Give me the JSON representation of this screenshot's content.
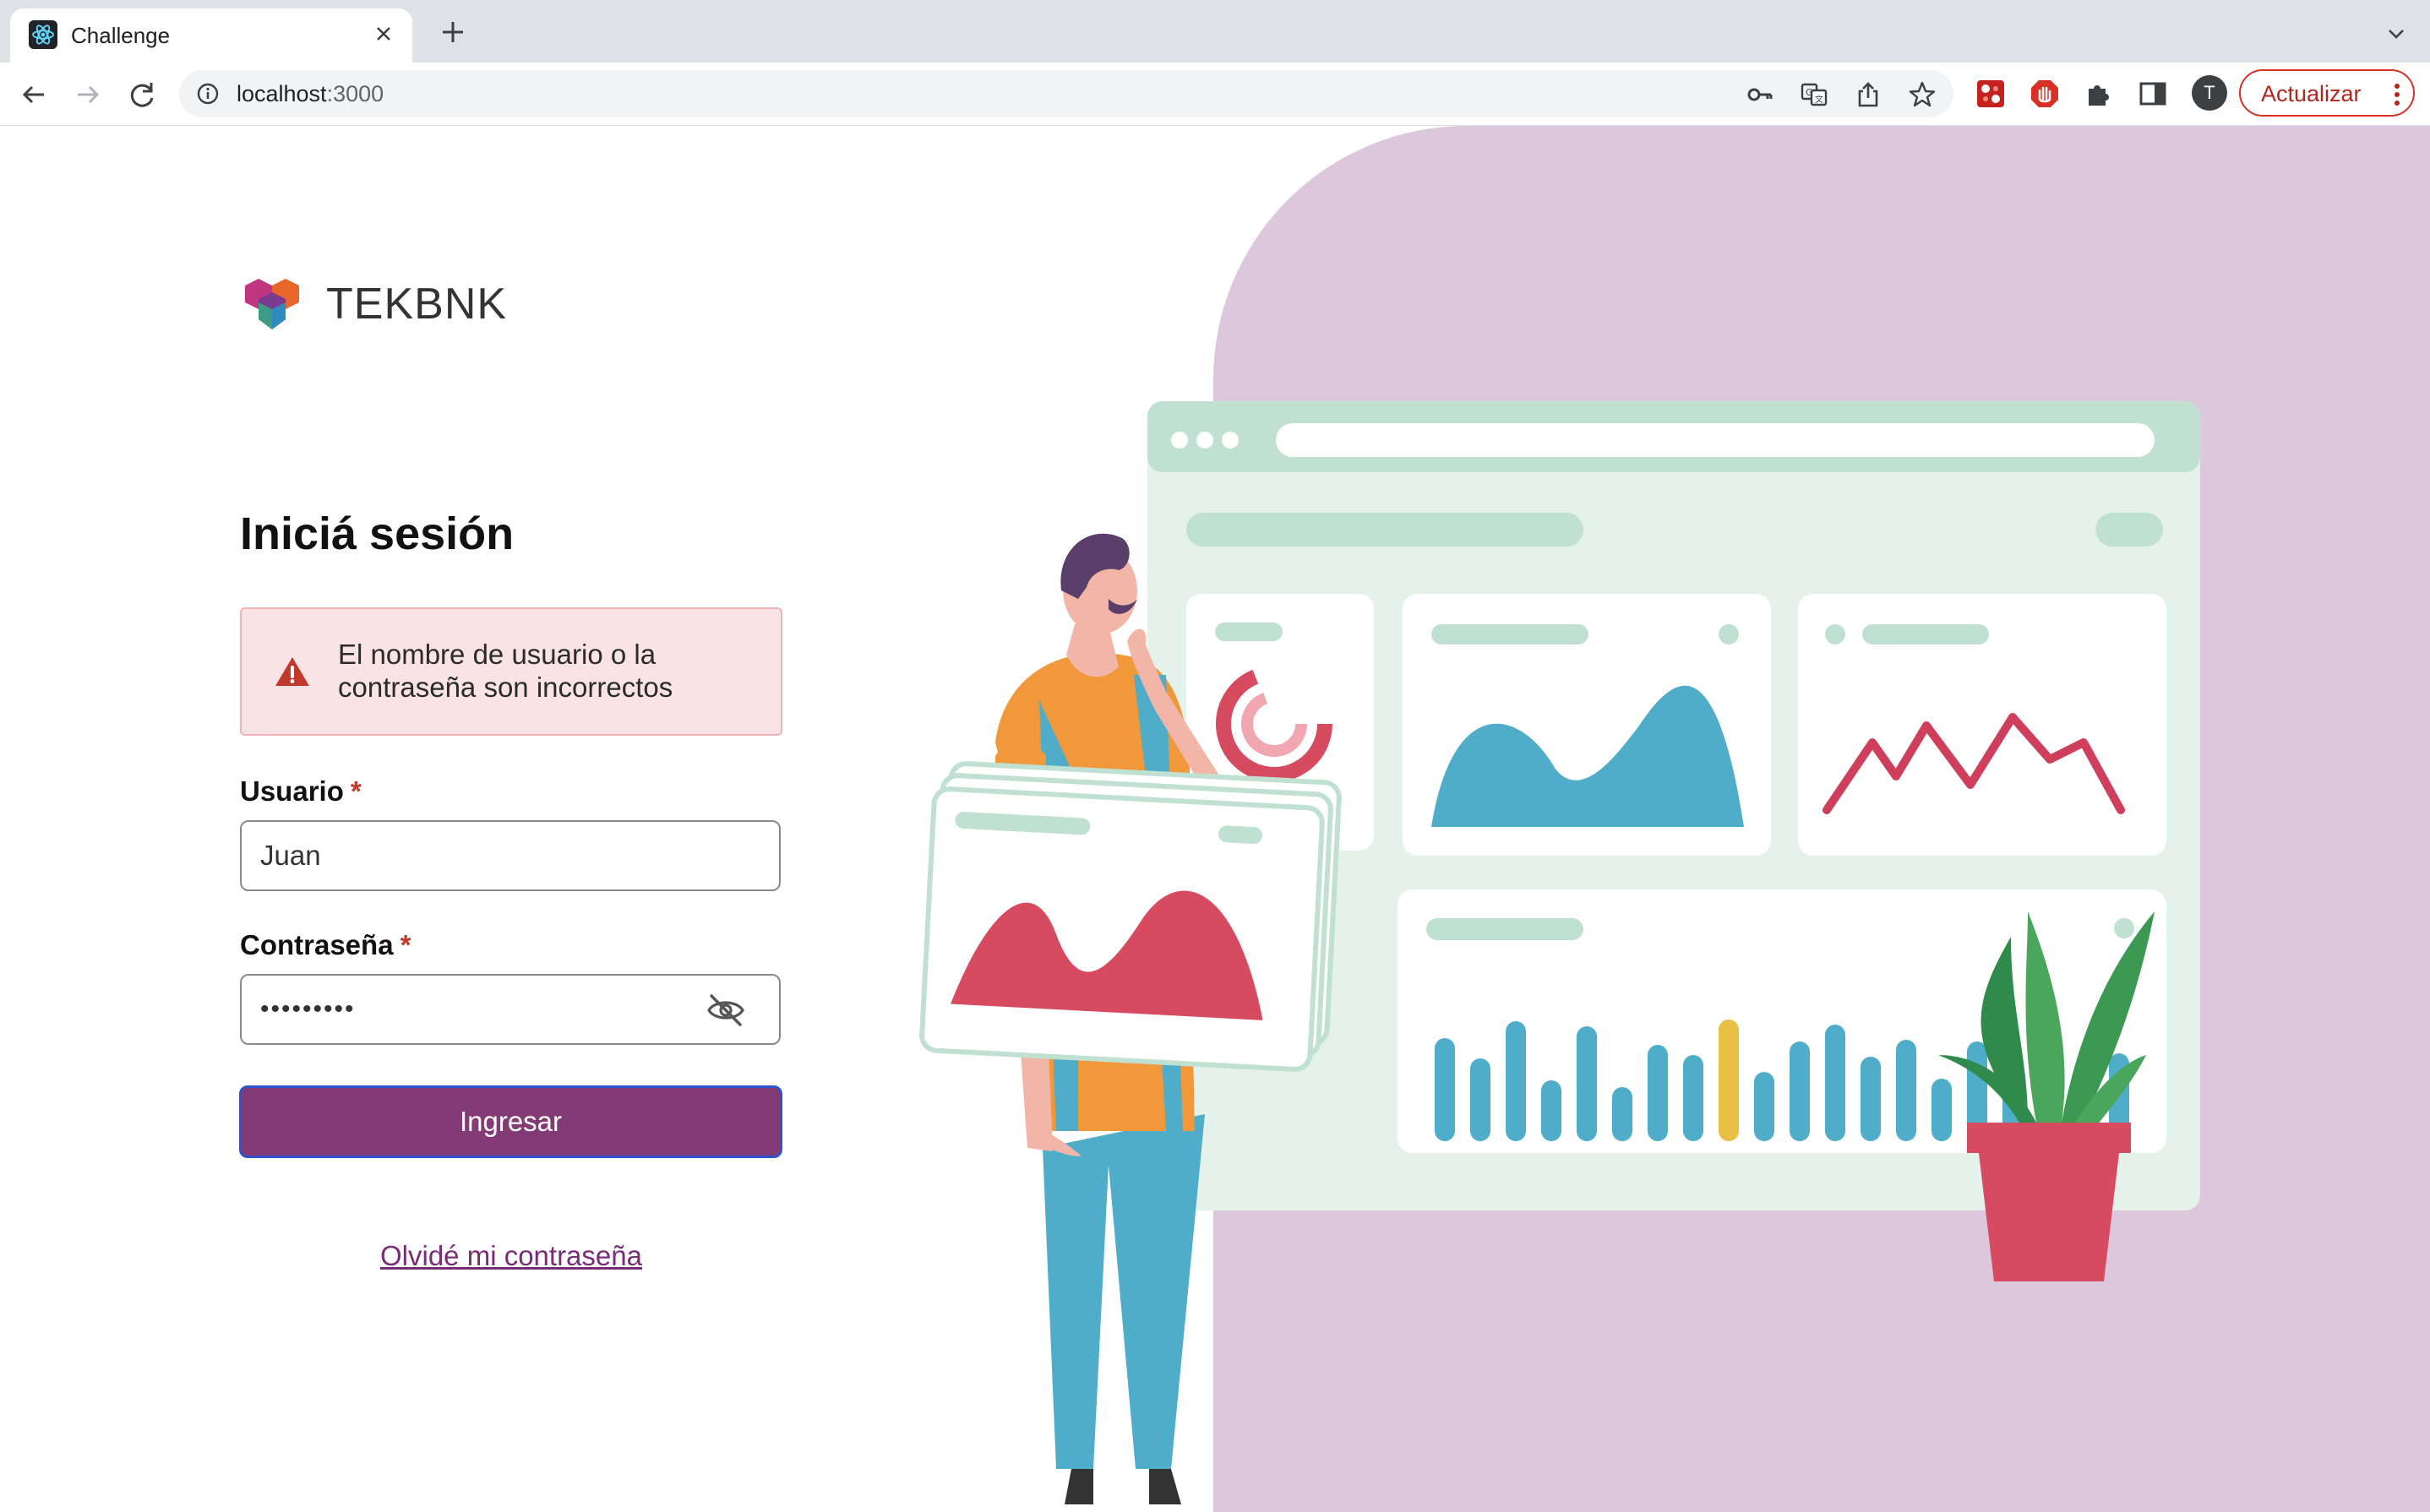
{
  "browser": {
    "tab_title": "Challenge",
    "url_host": "localhost",
    "url_port": ":3000",
    "profile_initial": "T",
    "update_button": "Actualizar"
  },
  "brand": {
    "name": "TEKBNK"
  },
  "login": {
    "title": "Iniciá sesión",
    "error_message": "El nombre de usuario o la contraseña son incorrectos",
    "username_label": "Usuario",
    "username_value": "Juan",
    "password_label": "Contraseña",
    "password_value": "•••••••••",
    "required_marker": "*",
    "submit_label": "Ingresar",
    "forgot_link": "Olvidé mi contraseña"
  },
  "colors": {
    "primary": "#823b75",
    "error_bg": "#fae3e4",
    "error_border": "#f0b4b7",
    "panel_bg": "#dcc7dd",
    "focus_border": "#2e54c9"
  },
  "icons": {
    "tab_favicon": "react-icon",
    "warning": "warning-triangle-icon",
    "password_toggle": "eye-off-icon"
  }
}
